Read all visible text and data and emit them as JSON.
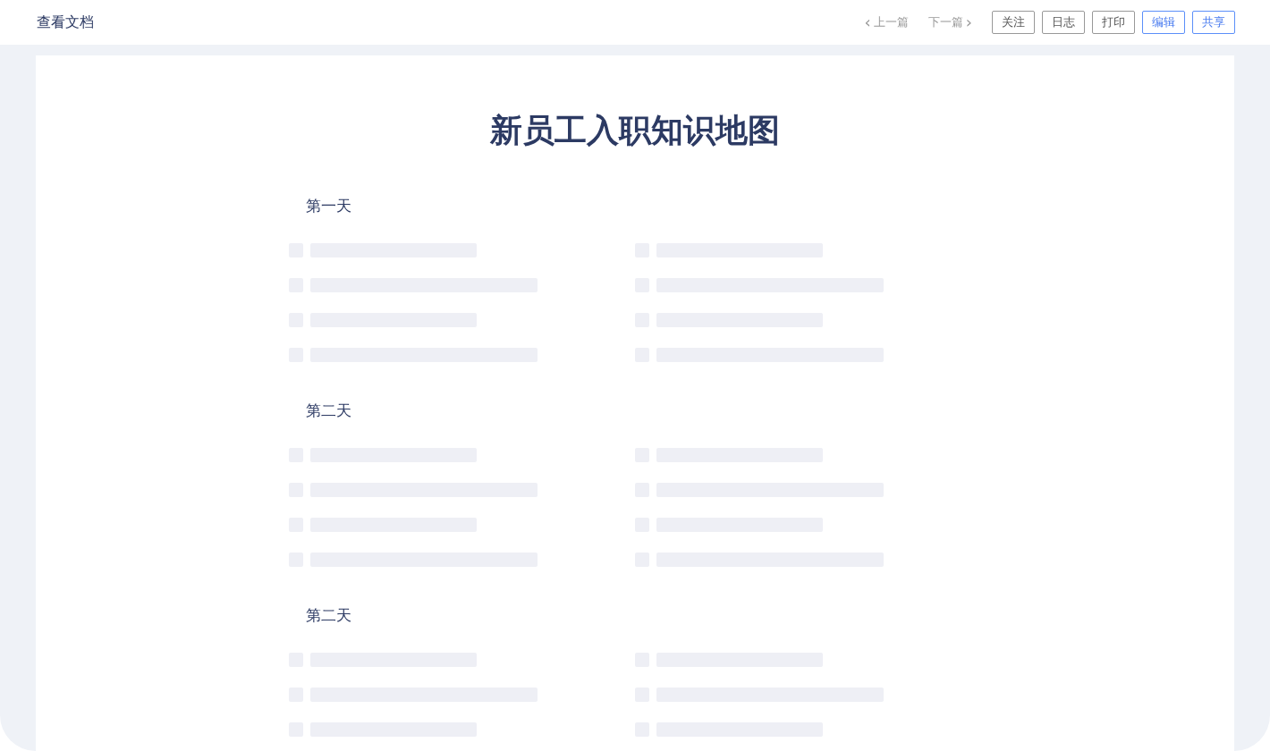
{
  "header": {
    "title": "查看文档",
    "prev": {
      "icon": "‹",
      "label": "上一篇"
    },
    "next": {
      "label": "下一篇",
      "icon": "›"
    },
    "buttons": [
      {
        "label": "关注",
        "kind": "default"
      },
      {
        "label": "日志",
        "kind": "default"
      },
      {
        "label": "打印",
        "kind": "default"
      },
      {
        "label": "编辑",
        "kind": "primary"
      },
      {
        "label": "共享",
        "kind": "primary"
      }
    ]
  },
  "document": {
    "title": "新员工入职知识地图",
    "sections": [
      {
        "title": "第一天",
        "columns": [
          {
            "lines": [
              {
                "kind": "short"
              },
              {
                "kind": "long"
              },
              {
                "kind": "short"
              },
              {
                "kind": "long"
              }
            ]
          },
          {
            "lines": [
              {
                "kind": "short"
              },
              {
                "kind": "long"
              },
              {
                "kind": "short"
              },
              {
                "kind": "long"
              }
            ]
          }
        ]
      },
      {
        "title": "第二天",
        "columns": [
          {
            "lines": [
              {
                "kind": "short"
              },
              {
                "kind": "long"
              },
              {
                "kind": "short"
              },
              {
                "kind": "long"
              }
            ]
          },
          {
            "lines": [
              {
                "kind": "short"
              },
              {
                "kind": "long"
              },
              {
                "kind": "short"
              },
              {
                "kind": "long"
              }
            ]
          }
        ]
      },
      {
        "title": "第二天",
        "columns": [
          {
            "lines": [
              {
                "kind": "short"
              },
              {
                "kind": "long"
              },
              {
                "kind": "short"
              }
            ]
          },
          {
            "lines": [
              {
                "kind": "short"
              },
              {
                "kind": "long"
              },
              {
                "kind": "short"
              }
            ]
          }
        ]
      }
    ]
  }
}
